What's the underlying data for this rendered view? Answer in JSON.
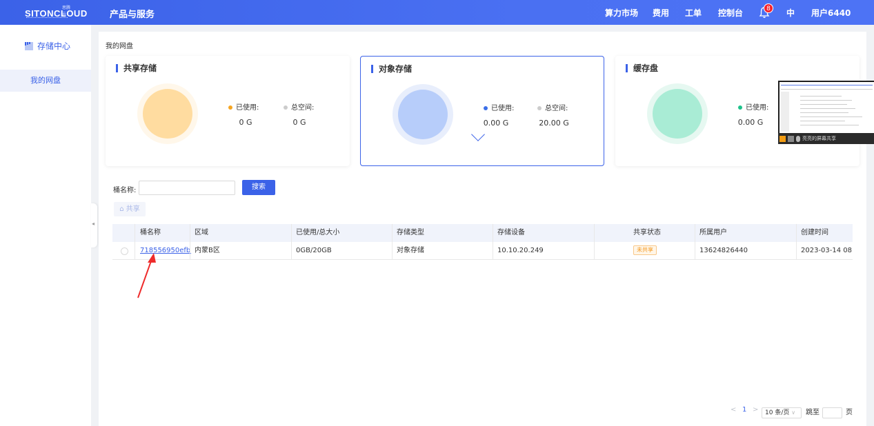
{
  "header": {
    "logo_text": "SITONCLOUD",
    "logo_sup": "思腾云",
    "product_menu": "产品与服务",
    "nav": [
      "算力市场",
      "费用",
      "工单",
      "控制台"
    ],
    "notification_count": "8",
    "language": "中",
    "user": "用户6440"
  },
  "sidebar": {
    "title": "存储中心",
    "items": [
      {
        "label": "我的网盘"
      }
    ]
  },
  "breadcrumb": "我的网盘",
  "cards": [
    {
      "title": "共享存储",
      "used_label": "已使用:",
      "total_label": "总空间:",
      "used": "0 G",
      "total": "0 G",
      "color": "#ffdca0"
    },
    {
      "title": "对象存储",
      "used_label": "已使用:",
      "total_label": "总空间:",
      "used": "0.00 G",
      "total": "20.00 G",
      "color": "#b7cdfa"
    },
    {
      "title": "缓存盘",
      "used_label": "已使用:",
      "used": "0.00 G",
      "color": "#a9ecd5"
    }
  ],
  "overlay": {
    "label": "亮亮的屏幕共享"
  },
  "search": {
    "label": "桶名称:",
    "value": "",
    "button": "搜索"
  },
  "share_button": "共享",
  "table": {
    "columns": [
      "桶名称",
      "区域",
      "已使用/总大小",
      "存储类型",
      "存储设备",
      "共享状态",
      "所属用户",
      "创建时间"
    ],
    "rows": [
      {
        "name": "718556950efb···",
        "region": "内蒙B区",
        "usage": "0GB/20GB",
        "type": "对象存储",
        "device": "10.10.20.249",
        "share_status": "未共享",
        "owner": "13624826440",
        "created": "2023-03-14 08:···"
      }
    ]
  },
  "pagination": {
    "prev": "<",
    "current": "1",
    "next": ">",
    "page_size": "10 条/页",
    "jump_label": "跳至",
    "page_unit": "页"
  },
  "colors": {
    "primary": "#3b62e8",
    "used_dot": [
      "#f5a623",
      "#3b6fe8",
      "#1ec28b"
    ],
    "total_dot": "#cccccc"
  }
}
